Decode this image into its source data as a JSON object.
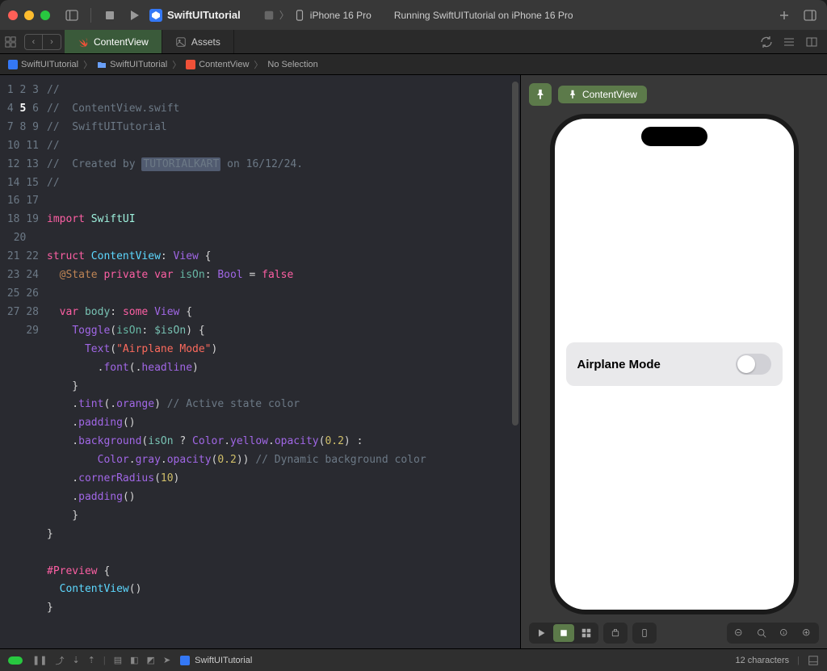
{
  "toolbar": {
    "project_name": "SwiftUITutorial",
    "scheme_app": "",
    "scheme_device": "iPhone 16 Pro",
    "status": "Running SwiftUITutorial on iPhone 16 Pro"
  },
  "tabs": [
    {
      "label": "ContentView",
      "icon": "swift",
      "active": true
    },
    {
      "label": "Assets",
      "icon": "assets",
      "active": false
    }
  ],
  "breadcrumb": [
    "SwiftUITutorial",
    "SwiftUITutorial",
    "ContentView",
    "No Selection"
  ],
  "canvas": {
    "badge": "ContentView",
    "toggle_label": "Airplane Mode"
  },
  "bottom": {
    "project": "SwiftUITutorial",
    "char_count": "12 characters"
  },
  "code": {
    "lines": [
      {
        "n": 1,
        "t": "comment",
        "s": "//"
      },
      {
        "n": 2,
        "t": "comment",
        "s": "//  ContentView.swift"
      },
      {
        "n": 3,
        "t": "comment",
        "s": "//  SwiftUITutorial"
      },
      {
        "n": 4,
        "t": "comment",
        "s": "//"
      },
      {
        "n": 5,
        "t": "created",
        "prefix": "//  Created by ",
        "author": "TUTORIALKART",
        "suffix": " on 16/12/24."
      },
      {
        "n": 6,
        "t": "comment",
        "s": "//"
      },
      {
        "n": 7,
        "t": "blank"
      },
      {
        "n": 8,
        "t": "import",
        "kw": "import",
        "mod": "SwiftUI"
      },
      {
        "n": 9,
        "t": "blank"
      },
      {
        "n": 10,
        "t": "struct",
        "kw": "struct",
        "name": "ContentView",
        "proto": "View"
      },
      {
        "n": 11,
        "t": "state",
        "attr": "@State",
        "priv": "private",
        "var": "var",
        "name": "isOn",
        "type": "Bool",
        "eq": "=",
        "val": "false"
      },
      {
        "n": 12,
        "t": "blank"
      },
      {
        "n": 13,
        "t": "body",
        "var": "var",
        "name": "body",
        "some": "some",
        "view": "View"
      },
      {
        "n": 14,
        "t": "toggle",
        "fn": "Toggle",
        "arg": "isOn",
        "bind": "$isOn"
      },
      {
        "n": 15,
        "t": "text",
        "fn": "Text",
        "str": "\"Airplane Mode\""
      },
      {
        "n": 16,
        "t": "font",
        "mod": "font",
        "arg": "headline"
      },
      {
        "n": 17,
        "t": "close1"
      },
      {
        "n": 18,
        "t": "tint",
        "mod": "tint",
        "arg": "orange",
        "comment": "// Active state color"
      },
      {
        "n": 19,
        "t": "pad",
        "mod": "padding"
      },
      {
        "n": 20,
        "t": "bg",
        "mod": "background",
        "cond": "isOn",
        "c1": "Color",
        "m1": "yellow",
        "op": "opacity",
        "v1": "0.2"
      },
      {
        "n": "",
        "t": "bg2",
        "c2": "Color",
        "m2": "gray",
        "op2": "opacity",
        "v2": "0.2",
        "comment": "// Dynamic background color"
      },
      {
        "n": 21,
        "t": "corner",
        "mod": "cornerRadius",
        "val": "10"
      },
      {
        "n": 22,
        "t": "pad",
        "mod": "padding"
      },
      {
        "n": 23,
        "t": "close1"
      },
      {
        "n": 24,
        "t": "close0"
      },
      {
        "n": 25,
        "t": "blank"
      },
      {
        "n": 26,
        "t": "preview",
        "attr": "#Preview"
      },
      {
        "n": 27,
        "t": "cv",
        "name": "ContentView"
      },
      {
        "n": 28,
        "t": "close0"
      },
      {
        "n": 29,
        "t": "blank"
      }
    ]
  }
}
